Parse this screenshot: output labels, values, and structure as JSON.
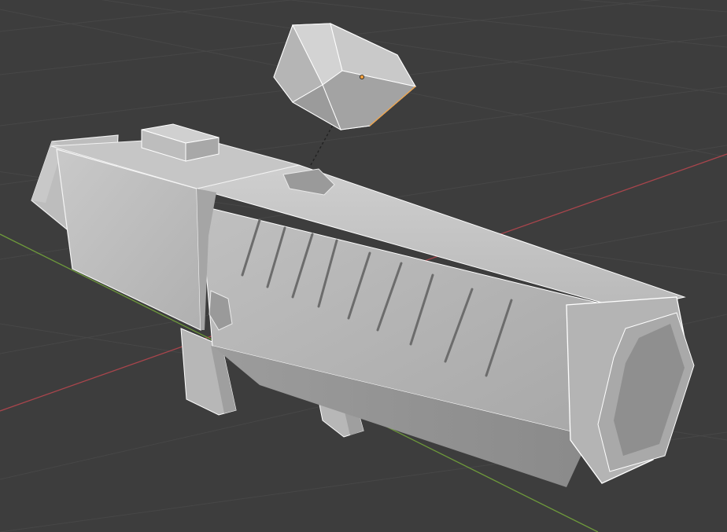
{
  "viewport": {
    "background": "#3d3d3d",
    "grid_color": "#474747",
    "x_axis_color": "#a8454c",
    "y_axis_color": "#6e9a3b",
    "origin_color": "#f0a040",
    "relationship_line_color": "#222222"
  },
  "scene": {
    "objects": [
      {
        "name": "launcher-body",
        "kind": "mesh"
      },
      {
        "name": "gem-sight",
        "kind": "mesh",
        "selected": true
      }
    ]
  }
}
